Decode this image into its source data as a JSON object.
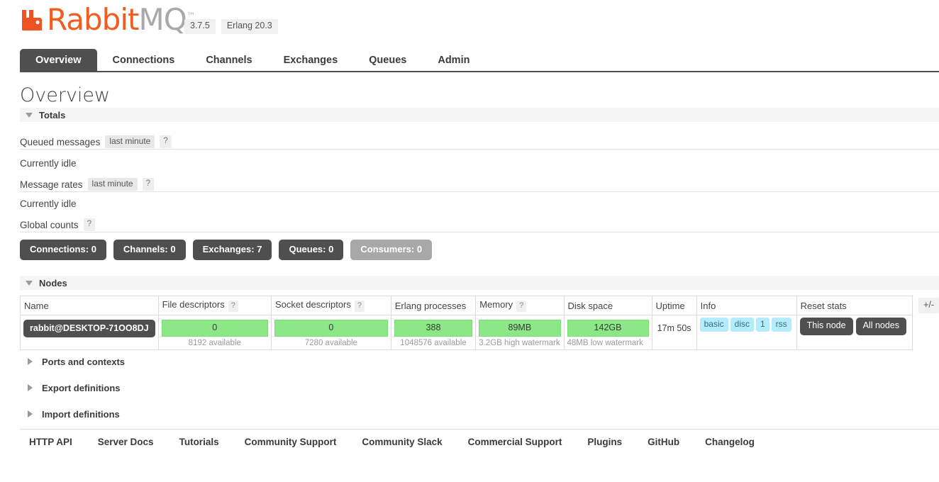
{
  "header": {
    "logo_primary": "Rabbit",
    "logo_secondary": "MQ",
    "logo_tm": "™",
    "version": "3.7.5",
    "erlang_version": "Erlang 20.3"
  },
  "nav": {
    "tabs": [
      {
        "label": "Overview",
        "active": true
      },
      {
        "label": "Connections",
        "active": false
      },
      {
        "label": "Channels",
        "active": false
      },
      {
        "label": "Exchanges",
        "active": false
      },
      {
        "label": "Queues",
        "active": false
      },
      {
        "label": "Admin",
        "active": false
      }
    ]
  },
  "page": {
    "title": "Overview"
  },
  "totals": {
    "section_label": "Totals",
    "queued_messages_label": "Queued messages",
    "queued_messages_period": "last minute",
    "queued_messages_help": "?",
    "queued_messages_status": "Currently idle",
    "message_rates_label": "Message rates",
    "message_rates_period": "last minute",
    "message_rates_help": "?",
    "message_rates_status": "Currently idle",
    "global_counts_label": "Global counts",
    "global_counts_help": "?"
  },
  "global_counts": [
    {
      "label": "Connections:",
      "value": "0",
      "muted": false
    },
    {
      "label": "Channels:",
      "value": "0",
      "muted": false
    },
    {
      "label": "Exchanges:",
      "value": "7",
      "muted": false
    },
    {
      "label": "Queues:",
      "value": "0",
      "muted": false
    },
    {
      "label": "Consumers:",
      "value": "0",
      "muted": true
    }
  ],
  "nodes": {
    "section_label": "Nodes",
    "columns": [
      {
        "label": "Name",
        "help": ""
      },
      {
        "label": "File descriptors",
        "help": "?"
      },
      {
        "label": "Socket descriptors",
        "help": "?"
      },
      {
        "label": "Erlang processes",
        "help": ""
      },
      {
        "label": "Memory",
        "help": "?"
      },
      {
        "label": "Disk space",
        "help": ""
      },
      {
        "label": "Uptime",
        "help": ""
      },
      {
        "label": "Info",
        "help": ""
      },
      {
        "label": "Reset stats",
        "help": ""
      }
    ],
    "toggle_columns_label": "+/-",
    "row": {
      "name": "rabbit@DESKTOP-71OO8DJ",
      "file_descriptors": "0",
      "file_descriptors_sub": "8192 available",
      "socket_descriptors": "0",
      "socket_descriptors_sub": "7280 available",
      "erlang_processes": "388",
      "erlang_processes_sub": "1048576 available",
      "memory": "89MB",
      "memory_sub": "3.2GB high watermark",
      "disk_space": "142GB",
      "disk_space_sub": "48MB low watermark",
      "uptime": "17m 50s",
      "info_tags": [
        "basic",
        "disc",
        "1",
        "rss"
      ],
      "reset_buttons": [
        "This node",
        "All nodes"
      ]
    }
  },
  "collapsed_sections": [
    {
      "label": "Ports and contexts"
    },
    {
      "label": "Export definitions"
    },
    {
      "label": "Import definitions"
    }
  ],
  "footer": {
    "links": [
      "HTTP API",
      "Server Docs",
      "Tutorials",
      "Community Support",
      "Community Slack",
      "Commercial Support",
      "Plugins",
      "GitHub",
      "Changelog"
    ]
  },
  "colors": {
    "accent": "#f25c1f",
    "dark": "#4f4f4f",
    "bar_green": "#8ce887",
    "info_blue": "#b5ecfb"
  }
}
